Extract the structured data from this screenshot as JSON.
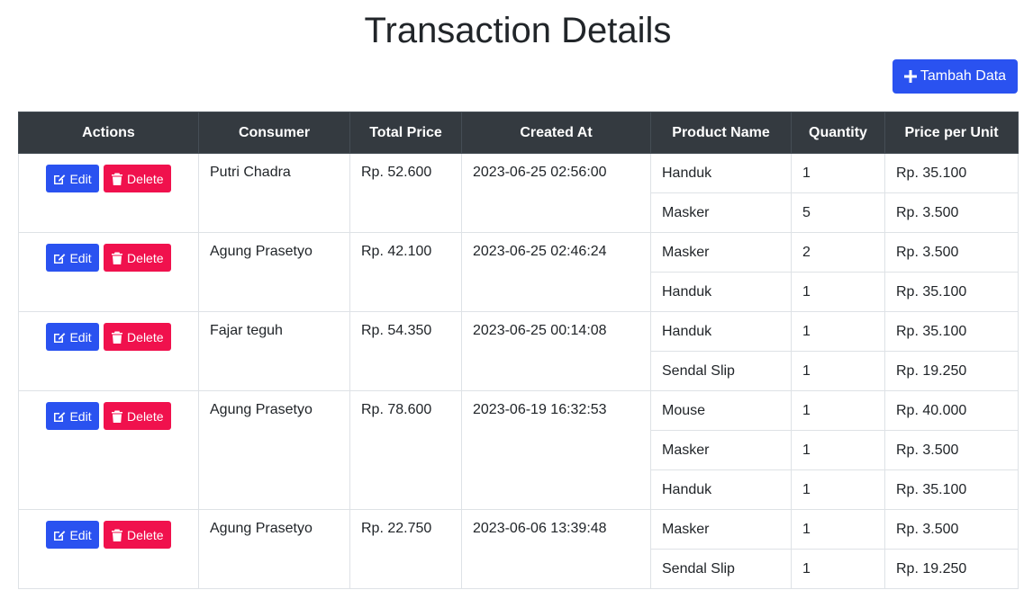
{
  "page": {
    "title": "Transaction Details"
  },
  "toolbar": {
    "add_label": "Tambah Data"
  },
  "table": {
    "headers": [
      "Actions",
      "Consumer",
      "Total Price",
      "Created At",
      "Product Name",
      "Quantity",
      "Price per Unit"
    ],
    "edit_label": "Edit",
    "delete_label": "Delete",
    "transactions": [
      {
        "consumer": "Putri Chadra",
        "total_price": "Rp. 52.600",
        "created_at": "2023-06-25 02:56:00",
        "items": [
          {
            "product": "Handuk",
            "quantity": "1",
            "price": "Rp. 35.100"
          },
          {
            "product": "Masker",
            "quantity": "5",
            "price": "Rp. 3.500"
          }
        ]
      },
      {
        "consumer": "Agung Prasetyo",
        "total_price": "Rp. 42.100",
        "created_at": "2023-06-25 02:46:24",
        "items": [
          {
            "product": "Masker",
            "quantity": "2",
            "price": "Rp. 3.500"
          },
          {
            "product": "Handuk",
            "quantity": "1",
            "price": "Rp. 35.100"
          }
        ]
      },
      {
        "consumer": "Fajar teguh",
        "total_price": "Rp. 54.350",
        "created_at": "2023-06-25 00:14:08",
        "items": [
          {
            "product": "Handuk",
            "quantity": "1",
            "price": "Rp. 35.100"
          },
          {
            "product": "Sendal Slip",
            "quantity": "1",
            "price": "Rp. 19.250"
          }
        ]
      },
      {
        "consumer": "Agung Prasetyo",
        "total_price": "Rp. 78.600",
        "created_at": "2023-06-19 16:32:53",
        "items": [
          {
            "product": "Mouse",
            "quantity": "1",
            "price": "Rp. 40.000"
          },
          {
            "product": "Masker",
            "quantity": "1",
            "price": "Rp. 3.500"
          },
          {
            "product": "Handuk",
            "quantity": "1",
            "price": "Rp. 35.100"
          }
        ]
      },
      {
        "consumer": "Agung Prasetyo",
        "total_price": "Rp. 22.750",
        "created_at": "2023-06-06 13:39:48",
        "items": [
          {
            "product": "Masker",
            "quantity": "1",
            "price": "Rp. 3.500"
          },
          {
            "product": "Sendal Slip",
            "quantity": "1",
            "price": "Rp. 19.250"
          }
        ]
      }
    ]
  }
}
